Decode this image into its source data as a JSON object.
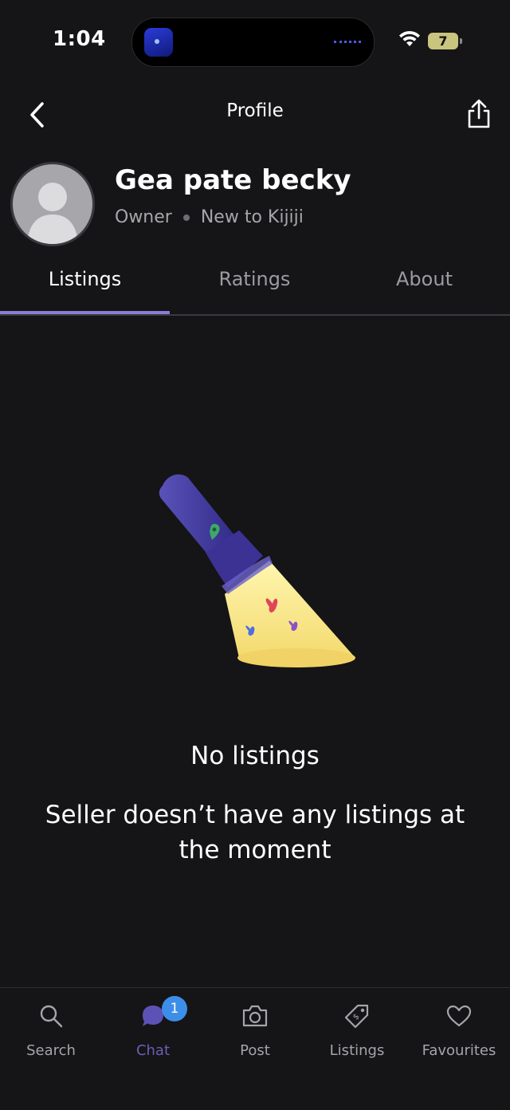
{
  "status_bar": {
    "time": "1:04",
    "battery": "7"
  },
  "header": {
    "title": "Profile"
  },
  "profile": {
    "name": "Gea pate becky",
    "role": "Owner",
    "status": "New to Kijiji"
  },
  "tabs": [
    {
      "label": "Listings",
      "active": true
    },
    {
      "label": "Ratings",
      "active": false
    },
    {
      "label": "About",
      "active": false
    }
  ],
  "empty_state": {
    "title": "No listings",
    "message": "Seller doesn’t have any listings at the moment"
  },
  "bottom_nav": [
    {
      "label": "Search",
      "icon": "search-icon"
    },
    {
      "label": "Chat",
      "icon": "chat-icon",
      "badge": "1",
      "active": true
    },
    {
      "label": "Post",
      "icon": "camera-icon"
    },
    {
      "label": "Listings",
      "icon": "price-tag-icon"
    },
    {
      "label": "Favourites",
      "icon": "heart-icon"
    }
  ],
  "colors": {
    "background": "#151416",
    "accent": "#8a7dd6",
    "badge": "#3d8ee8"
  }
}
